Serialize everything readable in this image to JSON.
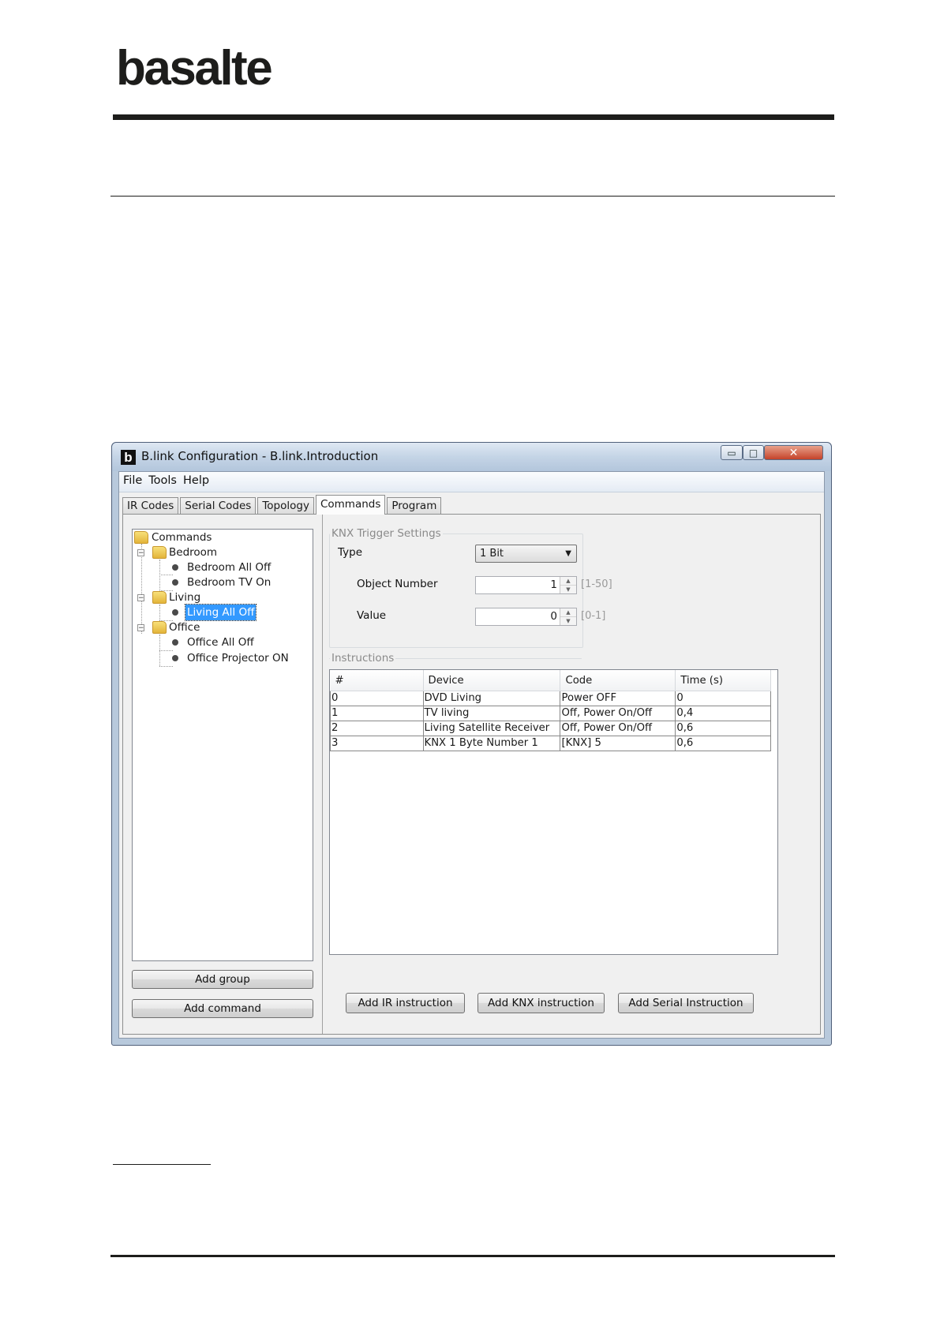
{
  "brand": {
    "logo_text": "basalte"
  },
  "window": {
    "icon_letter": "b",
    "title": "B.link Configuration - B.link.Introduction",
    "controls": {
      "minimize": "▭",
      "maximize": "□",
      "close": "✕"
    }
  },
  "menu": [
    "File",
    "Tools",
    "Help"
  ],
  "tabs": [
    {
      "label": "IR Codes",
      "active": false
    },
    {
      "label": "Serial Codes",
      "active": false
    },
    {
      "label": "Topology",
      "active": false
    },
    {
      "label": "Commands",
      "active": true
    },
    {
      "label": "Program",
      "active": false
    }
  ],
  "tree": {
    "root": "Commands",
    "groups": [
      {
        "label": "Bedroom",
        "items": [
          "Bedroom All Off",
          "Bedroom TV On"
        ]
      },
      {
        "label": "Living",
        "items": [
          "Living All Off"
        ]
      },
      {
        "label": "Office",
        "items": [
          "Office All Off",
          "Office Projector ON"
        ]
      }
    ],
    "selected": "Living All Off"
  },
  "left_buttons": {
    "add_group": "Add group",
    "add_command": "Add command"
  },
  "knx": {
    "section_title": "KNX Trigger Settings",
    "type_label": "Type",
    "type_value": "1 Bit",
    "object_number_label": "Object Number",
    "object_number_value": "1",
    "object_number_range": "[1-50]",
    "value_label": "Value",
    "value_value": "0",
    "value_range": "[0-1]"
  },
  "instructions": {
    "section_title": "Instructions",
    "columns": [
      "#",
      "Device",
      "Code",
      "Time (s)"
    ],
    "rows": [
      [
        "0",
        "DVD Living",
        "Power OFF",
        "0"
      ],
      [
        "1",
        "TV living",
        "Off, Power On/Off",
        "0,4"
      ],
      [
        "2",
        "Living Satellite Receiver",
        "Off, Power On/Off",
        "0,6"
      ],
      [
        "3",
        "KNX 1 Byte Number 1",
        "[KNX] 5",
        "0,6"
      ]
    ]
  },
  "bottom_buttons": {
    "add_ir": "Add IR instruction",
    "add_knx": "Add KNX instruction",
    "add_serial": "Add Serial Instruction"
  }
}
